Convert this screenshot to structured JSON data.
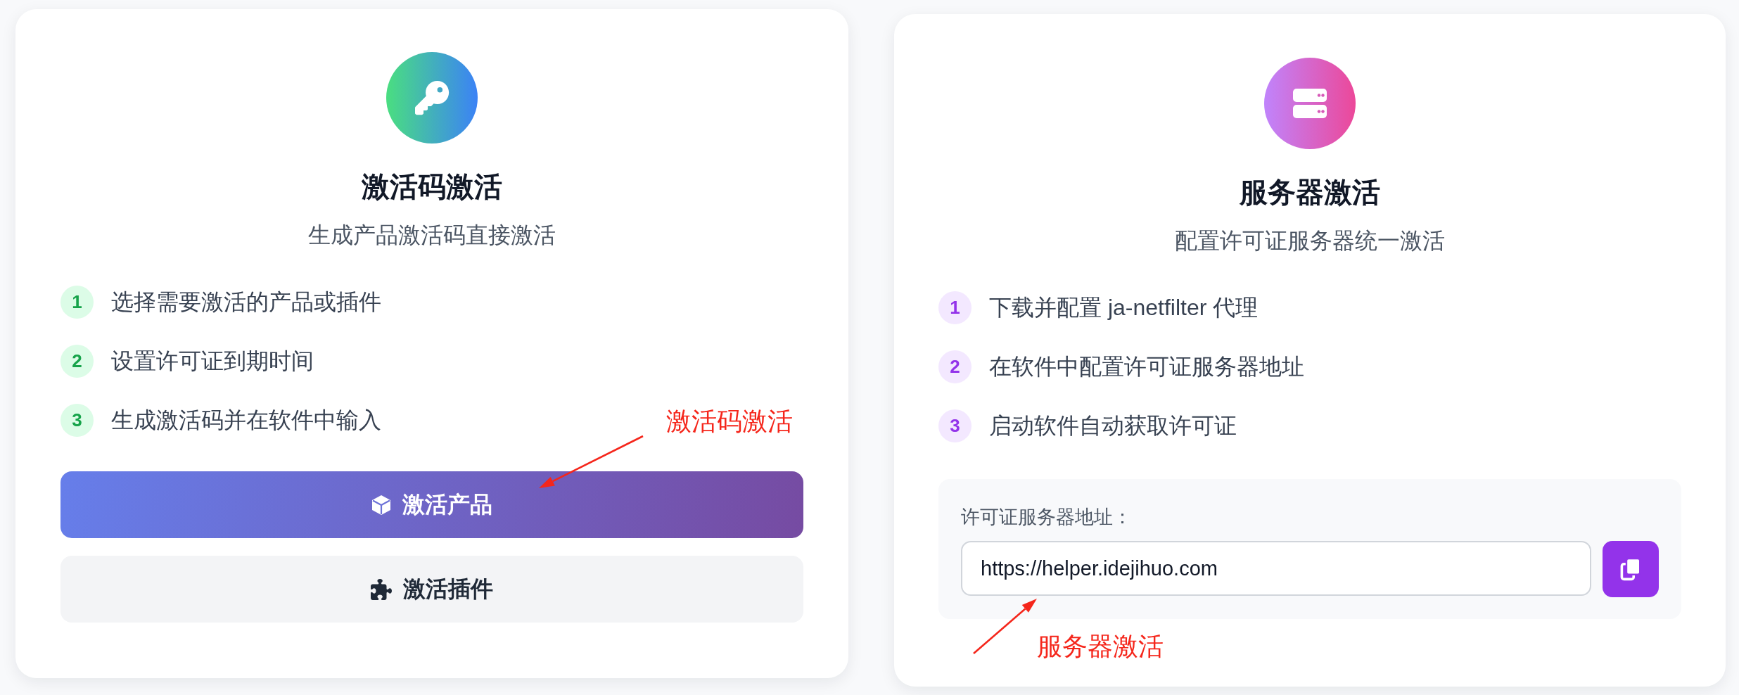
{
  "cards": [
    {
      "kind": "code",
      "title": "激活码激活",
      "subtitle": "生成产品激活码直接激活",
      "steps": [
        {
          "number": "1",
          "text": "选择需要激活的产品或插件"
        },
        {
          "number": "2",
          "text": "设置许可证到期时间"
        },
        {
          "number": "3",
          "text": "生成激活码并在软件中输入"
        }
      ],
      "buttons": [
        {
          "kind": "primary",
          "label": "激活产品"
        },
        {
          "kind": "secondary",
          "label": "激活插件"
        }
      ]
    },
    {
      "kind": "server",
      "title": "服务器激活",
      "subtitle": "配置许可证服务器统一激活",
      "steps": [
        {
          "number": "1",
          "text": "下载并配置 ja-netfilter 代理"
        },
        {
          "number": "2",
          "text": "在软件中配置许可证服务器地址"
        },
        {
          "number": "3",
          "text": "启动软件自动获取许可证"
        }
      ],
      "server_address": {
        "label": "许可证服务器地址：",
        "value": "https://helper.idejihuo.com"
      }
    }
  ],
  "annotations": [
    {
      "text": "激活码激活"
    },
    {
      "text": "服务器激活"
    }
  ]
}
